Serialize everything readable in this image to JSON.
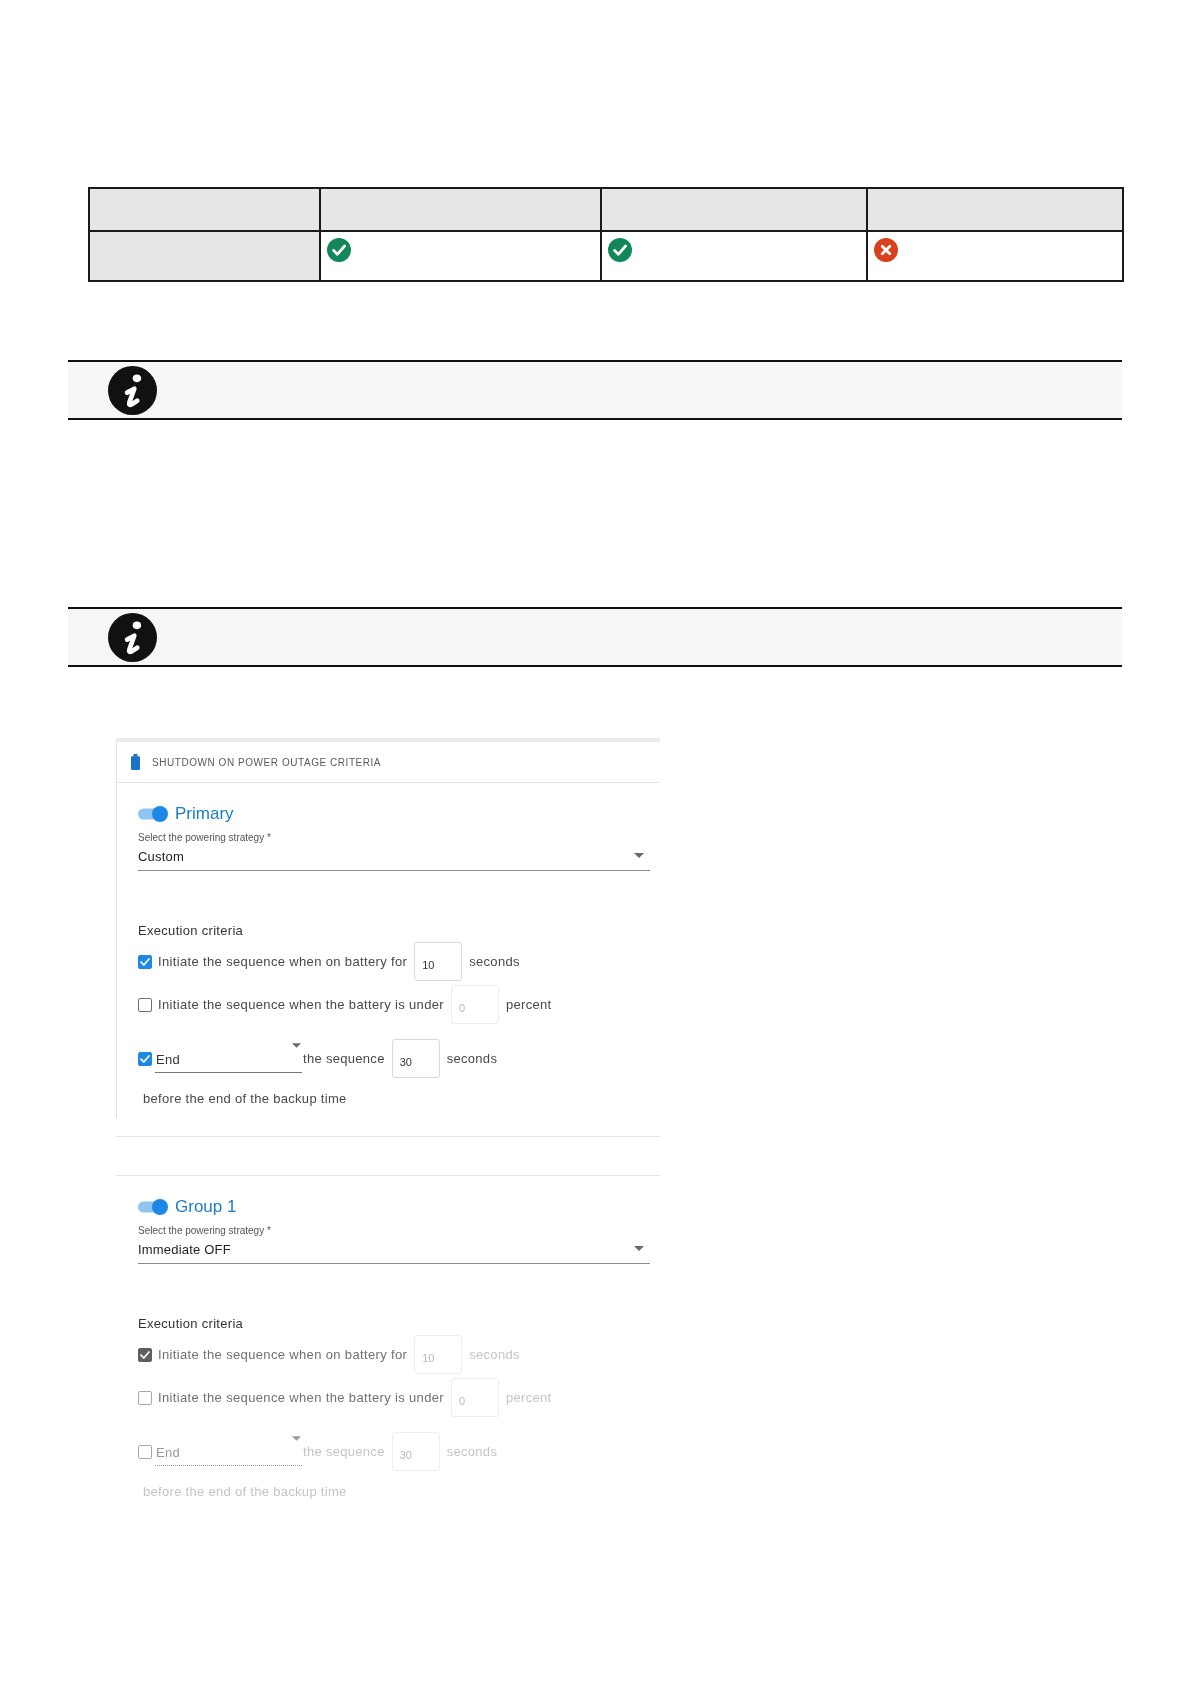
{
  "comparison_table": {
    "rows": [
      {
        "cells": [
          {
            "supported": true
          },
          {
            "supported": true
          },
          {
            "supported": false
          }
        ]
      }
    ]
  },
  "notes": [
    {
      "kind": "info"
    },
    {
      "kind": "info"
    }
  ],
  "settings_panel": {
    "title": "SHUTDOWN ON POWER OUTAGE CRITERIA",
    "groups": [
      {
        "name": "Primary",
        "enabled": true,
        "criteria_disabled": false,
        "strategy": {
          "label": "Select the powering strategy *",
          "value": "Custom"
        },
        "criteria_title": "Execution criteria",
        "criteria": [
          {
            "kind": "duration",
            "checked": true,
            "label": "Initiate the sequence when on battery for",
            "value": "10",
            "unit": "seconds"
          },
          {
            "kind": "level",
            "checked": false,
            "label": "Initiate the sequence when the battery is under",
            "value": "0",
            "unit": "percent"
          },
          {
            "kind": "end",
            "checked": true,
            "mode": "End",
            "label": "the sequence",
            "value": "30",
            "unit": "seconds",
            "note": "before the end of the backup time"
          }
        ]
      },
      {
        "name": "Group 1",
        "enabled": true,
        "criteria_disabled": true,
        "strategy": {
          "label": "Select the powering strategy *",
          "value": "Immediate OFF"
        },
        "criteria_title": "Execution criteria",
        "criteria": [
          {
            "kind": "duration",
            "checked": true,
            "label": "Initiate the sequence when on battery for",
            "value": "10",
            "unit": "seconds"
          },
          {
            "kind": "level",
            "checked": false,
            "label": "Initiate the sequence when the battery is under",
            "value": "0",
            "unit": "percent"
          },
          {
            "kind": "end",
            "checked": false,
            "mode": "End",
            "label": "the sequence",
            "value": "30",
            "unit": "seconds",
            "note": "before the end of the backup time"
          }
        ]
      }
    ]
  }
}
